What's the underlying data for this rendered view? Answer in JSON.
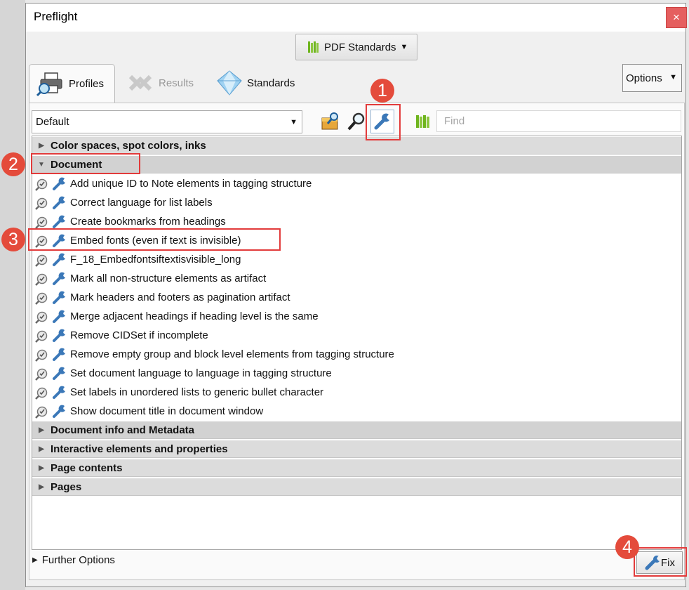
{
  "window": {
    "title": "Preflight",
    "close_glyph": "×"
  },
  "standards_dropdown": {
    "label": "PDF Standards",
    "icon": "library-icon"
  },
  "tabs": [
    {
      "label": "Profiles",
      "icon": "profiles-printer-magnifier-icon",
      "active": true
    },
    {
      "label": "Results",
      "icon": "results-icon",
      "active": false
    },
    {
      "label": "Standards",
      "icon": "standards-diamond-icon",
      "active": false
    }
  ],
  "options_button": {
    "label": "Options"
  },
  "profile_select": {
    "value": "Default"
  },
  "toolbar": {
    "edit_icon": "edit-profile-icon",
    "analyze_icon": "analyze-magnifier-icon",
    "fix_icon": "fix-wrench-icon",
    "library_icon": "library-icon",
    "find_placeholder": "Find"
  },
  "groups": {
    "color": {
      "label": "Color spaces, spot colors, inks",
      "expanded": false
    },
    "document": {
      "label": "Document",
      "expanded": true
    },
    "info": {
      "label": "Document info and Metadata",
      "expanded": false
    },
    "interactive": {
      "label": "Interactive elements and properties",
      "expanded": false
    },
    "page_contents": {
      "label": "Page contents",
      "expanded": false
    },
    "pages": {
      "label": "Pages",
      "expanded": false
    }
  },
  "document_items": [
    "Add unique ID to Note elements in tagging structure",
    "Correct language for list labels",
    "Create bookmarks from headings",
    "Embed fonts (even if text is invisible)",
    "F_18_Embedfontsiftextisvisible_long",
    "Mark all non-structure elements as artifact",
    "Mark headers and footers as pagination artifact",
    "Merge adjacent headings if heading level is the same",
    "Remove CIDSet if incomplete",
    "Remove empty group and block level elements from tagging structure",
    "Set document language to language in tagging structure",
    "Set labels in unordered lists to generic bullet character",
    "Show document title in document window"
  ],
  "further_options": {
    "label": "Further Options"
  },
  "fix_button": {
    "label": "Fix"
  },
  "callouts": [
    "1",
    "2",
    "3",
    "4"
  ],
  "colors": {
    "callout": "#e44b3b",
    "highlight_box": "#e23b3b",
    "close_button": "#e55f5f",
    "library_green": "#6fb51f"
  }
}
